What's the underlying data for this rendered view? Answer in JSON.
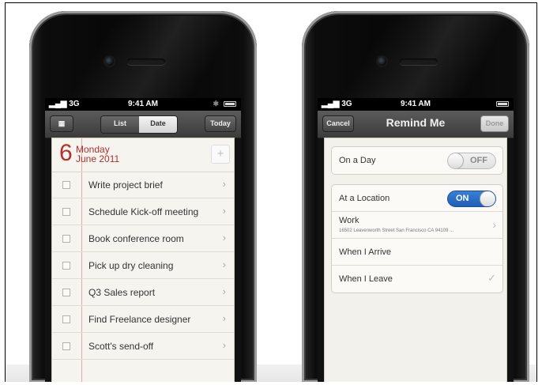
{
  "left_phone": {
    "status": {
      "signal": "3G",
      "time": "9:41 AM"
    },
    "nav": {
      "calendar_icon": "calendar-icon",
      "seg_list": "List",
      "seg_date": "Date",
      "today": "Today"
    },
    "date": {
      "day_number": "6",
      "weekday": "Monday",
      "month_year": "June 2011",
      "add_label": "+"
    },
    "tasks": [
      "Write project brief",
      "Schedule Kick-off meeting",
      "Book conference room",
      "Pick up dry cleaning",
      "Q3 Sales report",
      "Find Freelance designer",
      "Scott's send-off"
    ]
  },
  "right_phone": {
    "status": {
      "signal": "3G",
      "time": "9:41 AM"
    },
    "nav": {
      "cancel": "Cancel",
      "title": "Remind Me",
      "done": "Done"
    },
    "on_a_day": {
      "label": "On a Day",
      "toggle": "OFF"
    },
    "location": {
      "label": "At a Location",
      "toggle": "ON",
      "work_label": "Work",
      "work_address": "16502 Leavenworth Street San Francisco CA 94109 ...",
      "arrive": "When I Arrive",
      "leave": "When I Leave"
    }
  },
  "colors": {
    "accent_red": "#b0302e",
    "toggle_blue": "#2a6fcc"
  }
}
